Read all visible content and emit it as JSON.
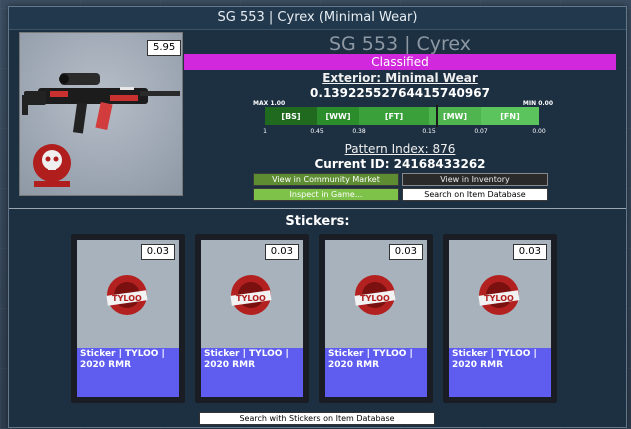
{
  "window": {
    "title": "SG 553 | Cyrex (Minimal Wear)"
  },
  "item": {
    "float_badge": "5.95",
    "name": "SG 553 | Cyrex",
    "rarity": "Classified",
    "rarity_color": "#d128dd",
    "exterior": "Exterior: Minimal Wear",
    "float_value": "0.13922552764415740967",
    "float_fraction": 0.139,
    "pattern_index": "Pattern Index: 876",
    "current_id": "Current ID: 24168433262",
    "logo_icon": "bloodhound-skull-icon"
  },
  "wear_bar": {
    "max_label": "MAX 1.00",
    "min_label": "MIN 0.00",
    "segments": [
      {
        "label": "[BS]",
        "color": "#1f6a1f"
      },
      {
        "label": "[WW]",
        "color": "#2a8c2a"
      },
      {
        "label": "[FT]",
        "color": "#3aa13a"
      },
      {
        "label": "[MW]",
        "color": "#4fb64f"
      },
      {
        "label": "[FN]",
        "color": "#5cc45c"
      }
    ],
    "ticks": [
      "1",
      "0.45",
      "0.38",
      "0.15",
      "0.07",
      "0.00"
    ]
  },
  "buttons": {
    "community_market": "View in Community Market",
    "inventory": "View in Inventory",
    "inspect": "Inspect in Game...",
    "item_database": "Search on Item Database"
  },
  "stickers": {
    "title": "Stickers:",
    "items": [
      {
        "float": "0.03",
        "name": "Sticker | TYLOO | 2020 RMR",
        "art_text": "TYLOO"
      },
      {
        "float": "0.03",
        "name": "Sticker | TYLOO | 2020 RMR",
        "art_text": "TYLOO"
      },
      {
        "float": "0.03",
        "name": "Sticker | TYLOO | 2020 RMR",
        "art_text": "TYLOO"
      },
      {
        "float": "0.03",
        "name": "Sticker | TYLOO | 2020 RMR",
        "art_text": "TYLOO"
      }
    ],
    "search_button": "Search with Stickers on Item Database"
  }
}
